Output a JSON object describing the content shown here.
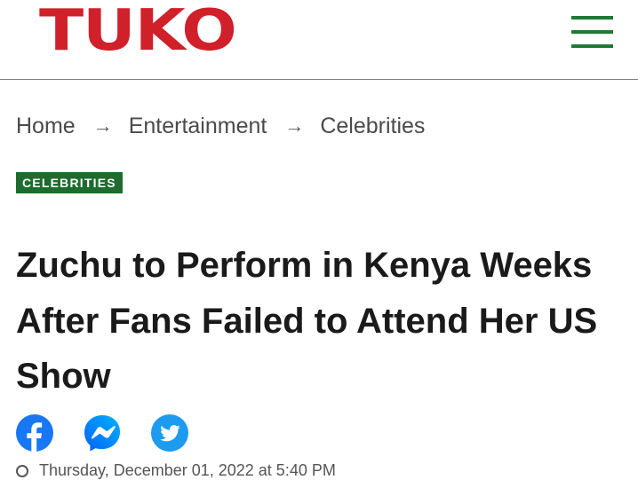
{
  "header": {
    "logo_text": "TUKO",
    "menu_icon": "hamburger-menu-icon",
    "brand_color": "#d0202a",
    "accent_color": "#1d7a32"
  },
  "breadcrumb": {
    "items": [
      "Home",
      "Entertainment",
      "Celebrities"
    ],
    "separator": "→"
  },
  "category_badge": "CELEBRITIES",
  "article": {
    "title": "Zuchu to Perform in Kenya Weeks After Fans Failed to Attend Her US Show",
    "date_text": "Thursday, December 01, 2022 at 5:40 PM"
  },
  "share": {
    "icons": [
      "facebook-icon",
      "messenger-icon",
      "twitter-icon"
    ]
  }
}
